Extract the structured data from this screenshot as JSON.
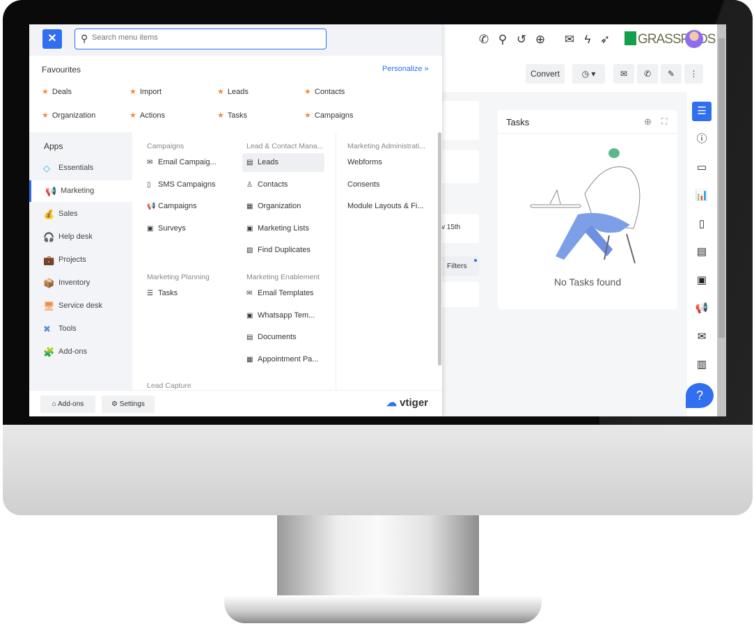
{
  "header": {
    "search_placeholder": "Search menu items",
    "close_icon": "close-icon",
    "search_icon": "search-icon"
  },
  "topbar": {
    "icons": [
      "phone-icon",
      "search-icon",
      "history-icon",
      "add-icon",
      "inbox-icon",
      "lightning-icon",
      "rocket-icon"
    ],
    "brand": "GRASSPODS"
  },
  "actions": {
    "convert": "Convert"
  },
  "favourites": {
    "title": "Favourites",
    "personalize": "Personalize »",
    "items": [
      "Deals",
      "Import",
      "Leads",
      "Contacts",
      "Organization",
      "Actions",
      "Tasks",
      "Campaigns"
    ]
  },
  "apps": {
    "title": "Apps",
    "items": [
      {
        "label": "Essentials",
        "icon": "◇",
        "color": "#1fb6d6"
      },
      {
        "label": "Marketing",
        "icon": "📢",
        "color": "#6b6bf0",
        "active": true
      },
      {
        "label": "Sales",
        "icon": "💰",
        "color": "#f08a3c"
      },
      {
        "label": "Help desk",
        "icon": "🎧",
        "color": "#f08a3c"
      },
      {
        "label": "Projects",
        "icon": "💼",
        "color": "#e84fa8"
      },
      {
        "label": "Inventory",
        "icon": "📦",
        "color": "#1fb6d6"
      },
      {
        "label": "Service desk",
        "icon": "🖥",
        "color": "#f08a3c"
      },
      {
        "label": "Tools",
        "icon": "✖",
        "color": "#5a8fd6"
      },
      {
        "label": "Add-ons",
        "icon": "🧩",
        "color": "#e85a5a"
      }
    ]
  },
  "menu": {
    "campaigns": {
      "title": "Campaigns",
      "items": [
        "Email Campaig...",
        "SMS Campaigns",
        "Campaigns",
        "Surveys"
      ]
    },
    "lead_contact": {
      "title": "Lead & Contact Mana...",
      "items": [
        "Leads",
        "Contacts",
        "Organization",
        "Marketing Lists",
        "Find Duplicates"
      ]
    },
    "admin": {
      "title": "Marketing Administrati...",
      "items": [
        "Webforms",
        "Consents",
        "Module Layouts & Fi..."
      ]
    },
    "planning": {
      "title": "Marketing Planning",
      "items": [
        "Tasks"
      ]
    },
    "enablement": {
      "title": "Marketing Enablement",
      "items": [
        "Email Templates",
        "Whatsapp Tem...",
        "Documents",
        "Appointment Pa..."
      ]
    },
    "lead_capture": {
      "title": "Lead Capture"
    }
  },
  "footer": {
    "addons": "Add-ons",
    "settings": "Settings",
    "logo_prefix": "v",
    "logo": "tiger"
  },
  "background": {
    "date_fragment": "v 15th",
    "filters": "Filters",
    "tasks_title": "Tasks",
    "no_tasks": "No Tasks found"
  },
  "colors": {
    "accent": "#2f6ff0",
    "star": "#f08a3c"
  }
}
